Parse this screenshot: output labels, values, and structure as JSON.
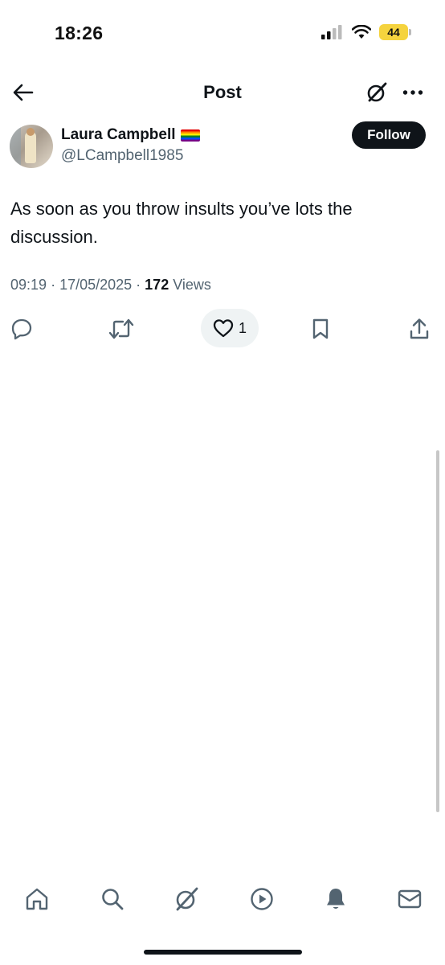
{
  "status_bar": {
    "time": "18:26",
    "battery": "44"
  },
  "header": {
    "title": "Post"
  },
  "post": {
    "author_name": "Laura Campbell",
    "author_handle": "@LCampbell1985",
    "follow_label": "Follow",
    "text": "As soon as you throw insults you’ve lots the discussion.",
    "time": "09:19",
    "date": "17/05/2025",
    "views_count": "172",
    "views_label": "Views",
    "like_count": "1"
  },
  "tabs": [
    "home",
    "search",
    "grok",
    "video",
    "notifications",
    "messages"
  ],
  "colors": {
    "text": "#0f1419",
    "secondary": "#536471",
    "battery": "#f5d33e"
  }
}
